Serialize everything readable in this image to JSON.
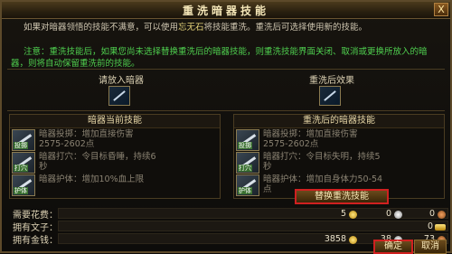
{
  "window": {
    "title": "重洗暗器技能",
    "close_label": "X"
  },
  "desc": {
    "line_a": "如果对暗器领悟的技能不满意，可以使用",
    "item_name": "忘无石",
    "line_b": "将技能重洗。重洗后可选择使用新的技能。"
  },
  "tip": "注意：重洗技能后，如果您尚未选择替换重洗后的暗器技能，则重洗技能界面关闭、取消或更换所放入的暗器，则将自动保留重洗前的技能。",
  "left_col": {
    "header": "请放入暗器",
    "panel_title": "暗器当前技能"
  },
  "right_col": {
    "header": "重洗后效果",
    "panel_title": "重洗后的暗器技能"
  },
  "left_skills": [
    {
      "tag": "投掷",
      "line1": "暗器投掷：增加直接伤害",
      "line2": "2575-2602点"
    },
    {
      "tag": "打穴",
      "line1": "暗器打穴：令目标昏睡，持续6",
      "line2": "秒"
    },
    {
      "tag": "护体",
      "line1": "暗器护体：增加10%血上限",
      "line2": ""
    }
  ],
  "right_skills": [
    {
      "tag": "投掷",
      "line1": "暗器投掷：增加直接伤害",
      "line2": "2575-2602点"
    },
    {
      "tag": "打穴",
      "line1": "暗器打穴：令目标失明，持续5",
      "line2": "秒"
    },
    {
      "tag": "护体",
      "line1": "暗器护体：增加自身体力50-54",
      "line2": "点"
    }
  ],
  "swap_button": "替换重洗技能",
  "costs": {
    "need_label": "需要花费：",
    "need_gold": "5",
    "need_silver": "0",
    "need_copper": "0",
    "own_item_label": "拥有文子：",
    "own_item_value": "0",
    "own_money_label": "拥有金钱：",
    "own_gold": "3858",
    "own_silver": "38",
    "own_copper": "73"
  },
  "buttons": {
    "ok": "确定",
    "cancel": "取消"
  }
}
